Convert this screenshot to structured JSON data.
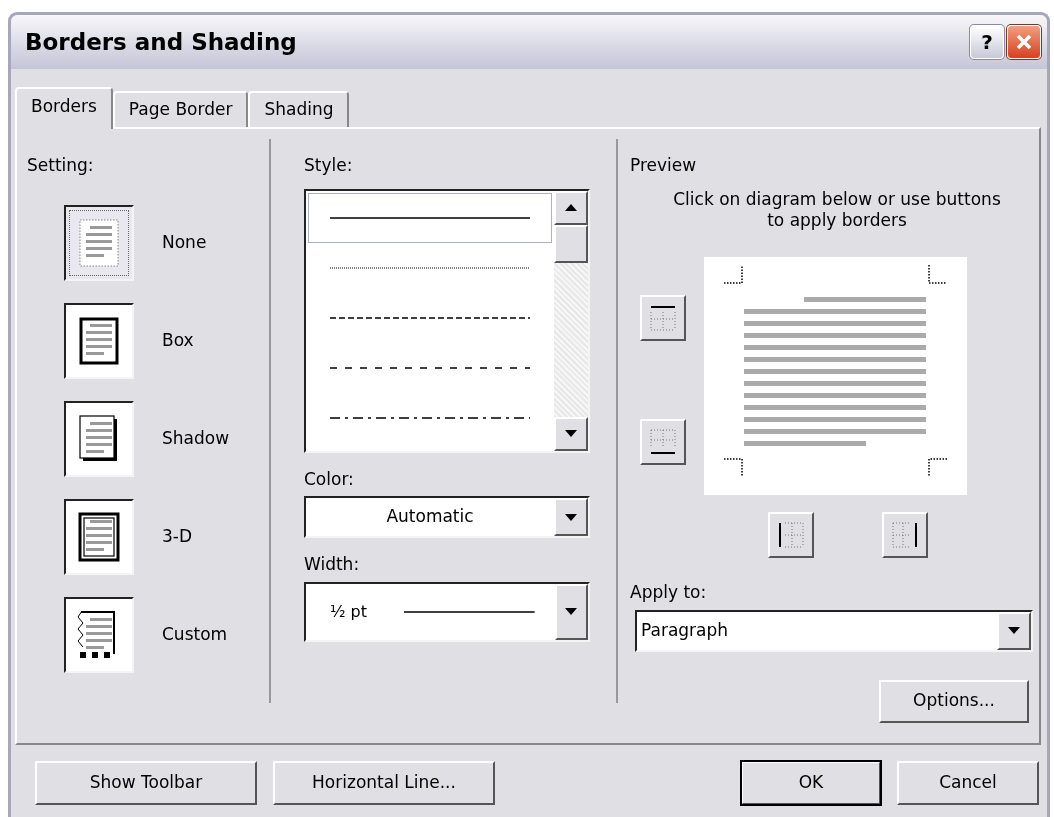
{
  "window": {
    "title": "Borders and Shading",
    "help_button": "?"
  },
  "tabs": [
    {
      "label": "Borders",
      "selected": true
    },
    {
      "label": "Page Border",
      "selected": false
    },
    {
      "label": "Shading",
      "selected": false
    }
  ],
  "setting": {
    "label": "Setting:",
    "items": [
      {
        "kind": "none",
        "label": "None",
        "selected": true
      },
      {
        "kind": "box",
        "label": "Box",
        "selected": false
      },
      {
        "kind": "shadow",
        "label": "Shadow",
        "selected": false
      },
      {
        "kind": "threed",
        "label": "3-D",
        "selected": false
      },
      {
        "kind": "custom",
        "label": "Custom",
        "selected": false
      }
    ]
  },
  "style": {
    "label": "Style:",
    "items": [
      {
        "kind": "solid",
        "selected": true
      },
      {
        "kind": "dotted",
        "selected": false
      },
      {
        "kind": "dashed",
        "selected": false
      },
      {
        "kind": "long-dash",
        "selected": false
      },
      {
        "kind": "dash-dot",
        "selected": false
      }
    ]
  },
  "color": {
    "label": "Color:",
    "value": "Automatic"
  },
  "width": {
    "label": "Width:",
    "value": "½ pt"
  },
  "preview": {
    "label": "Preview",
    "hint": "Click on diagram below or use buttons to apply borders"
  },
  "apply_to": {
    "label": "Apply to:",
    "value": "Paragraph"
  },
  "options_button": "Options...",
  "footer_buttons": [
    {
      "label": "Show Toolbar",
      "default": false
    },
    {
      "label": "Horizontal Line...",
      "default": false
    },
    {
      "label": "OK",
      "default": true
    },
    {
      "label": "Cancel",
      "default": false
    }
  ]
}
